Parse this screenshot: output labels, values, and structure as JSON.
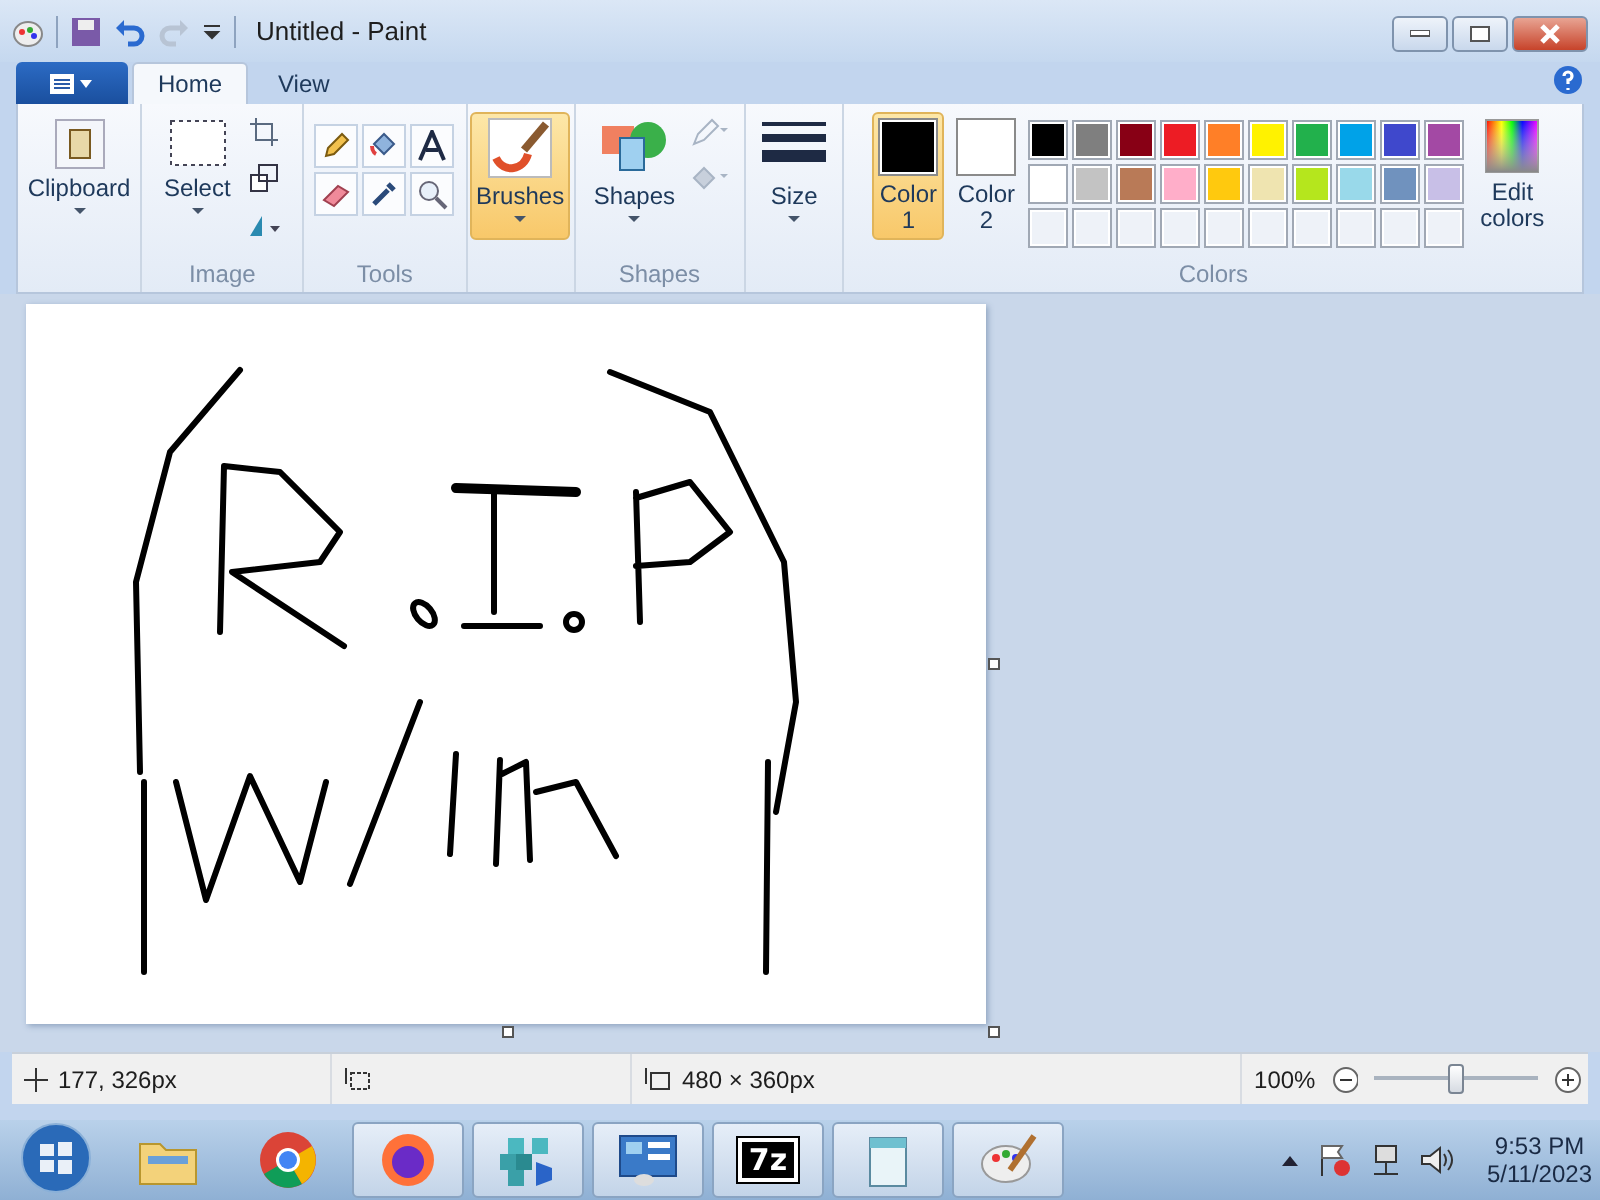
{
  "window": {
    "title": "Untitled - Paint"
  },
  "tabs": [
    {
      "label": "Home",
      "selected": true
    },
    {
      "label": "View",
      "selected": false
    }
  ],
  "ribbon": {
    "clipboard": "Clipboard",
    "select": "Select",
    "image_label": "Image",
    "tools_label": "Tools",
    "brushes": {
      "label": "Brushes",
      "selected": true
    },
    "shapes": "Shapes",
    "shapes_label": "Shapes",
    "size": "Size",
    "colors_label": "Colors",
    "edit_colors": "Edit colors"
  },
  "color_slots": [
    {
      "label": "Color",
      "number": "1",
      "color": "#000000",
      "selected": true
    },
    {
      "label": "Color",
      "number": "2",
      "color": "#ffffff",
      "selected": false
    }
  ],
  "palette": [
    {
      "color": "#000000"
    },
    {
      "color": "#7f7f7f"
    },
    {
      "color": "#880015"
    },
    {
      "color": "#ed1c24"
    },
    {
      "color": "#ff7f27"
    },
    {
      "color": "#fff200"
    },
    {
      "color": "#22b14c"
    },
    {
      "color": "#00a2e8"
    },
    {
      "color": "#3f48cc"
    },
    {
      "color": "#a349a4"
    },
    {
      "color": "#ffffff"
    },
    {
      "color": "#c3c3c3"
    },
    {
      "color": "#b97a57"
    },
    {
      "color": "#ffaec9"
    },
    {
      "color": "#ffc90e"
    },
    {
      "color": "#efe4b0"
    },
    {
      "color": "#b5e61d"
    },
    {
      "color": "#99d9ea"
    },
    {
      "color": "#7092be"
    },
    {
      "color": "#c8bfe7"
    }
  ],
  "status_bar": {
    "position": "177, 326px",
    "canvas_size": "480 × 360px",
    "zoom": "100%",
    "zoom_level": {
      "level": 0.49
    }
  },
  "taskbar": {
    "apps": [
      {
        "kind": "explorer"
      },
      {
        "kind": "chrome"
      },
      {
        "kind": "firefox"
      },
      {
        "kind": "registry"
      },
      {
        "kind": "control"
      },
      {
        "kind": "sevenzip",
        "label": "7z"
      },
      {
        "kind": "notepad"
      },
      {
        "kind": "paint"
      }
    ],
    "time": "9:53 PM",
    "date": "5/11/2023"
  }
}
